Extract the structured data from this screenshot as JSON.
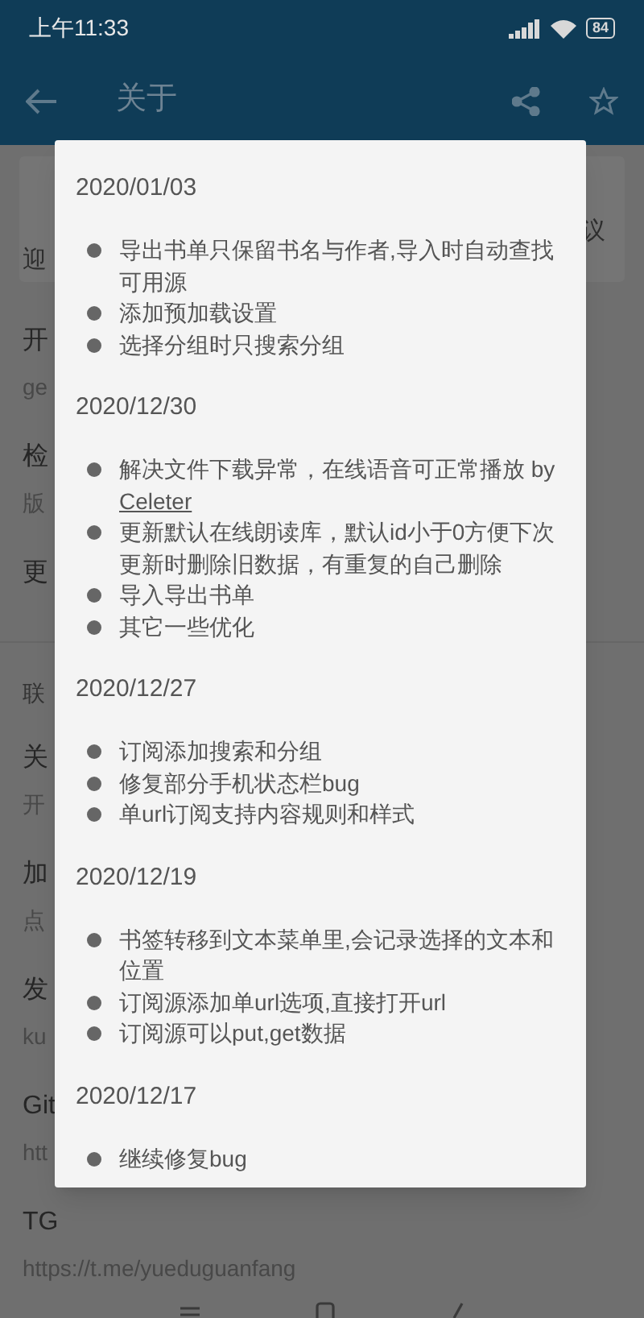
{
  "status_bar": {
    "time": "上午11:33",
    "battery": "84"
  },
  "app_bar": {
    "title": "关于"
  },
  "card": {
    "line_1": "议",
    "line_2": "迎"
  },
  "items_1": [
    {
      "title": "开",
      "subtitle": "ge"
    },
    {
      "title": "检",
      "subtitle": "版"
    },
    {
      "title": "更"
    }
  ],
  "section_header": "联",
  "items_2": [
    {
      "title": "关",
      "subtitle": "开"
    },
    {
      "title": "加",
      "subtitle": "点"
    },
    {
      "title": "发",
      "subtitle": "ku"
    },
    {
      "title": "Git",
      "subtitle": "htt"
    },
    {
      "title": "TG",
      "subtitle": "https://t.me/yueduguanfang"
    }
  ],
  "dialog": {
    "entries": [
      {
        "date": "2020/01/03",
        "changes": [
          {
            "text": "导出书单只保留书名与作者,导入时自动查找可用源"
          },
          {
            "text": "添加预加载设置"
          },
          {
            "text": "选择分组时只搜索分组"
          }
        ]
      },
      {
        "date": "2020/12/30",
        "changes": [
          {
            "text": "解决文件下载异常，在线语音可正常播放 by",
            "link": "Celeter"
          },
          {
            "text": "更新默认在线朗读库，默认id小于0方便下次更新时删除旧数据，有重复的自己删除"
          },
          {
            "text": "导入导出书单"
          },
          {
            "text": "其它一些优化"
          }
        ]
      },
      {
        "date": "2020/12/27",
        "changes": [
          {
            "text": "订阅添加搜索和分组"
          },
          {
            "text": "修复部分手机状态栏bug"
          },
          {
            "text": "单url订阅支持内容规则和样式"
          }
        ]
      },
      {
        "date": "2020/12/19",
        "changes": [
          {
            "text": "书签转移到文本菜单里,会记录选择的文本和位置"
          },
          {
            "text": "订阅源添加单url选项,直接打开url"
          },
          {
            "text": "订阅源可以put,get数据"
          }
        ]
      },
      {
        "date": "2020/12/17",
        "changes": [
          {
            "text": "继续修复bug"
          }
        ]
      }
    ]
  }
}
